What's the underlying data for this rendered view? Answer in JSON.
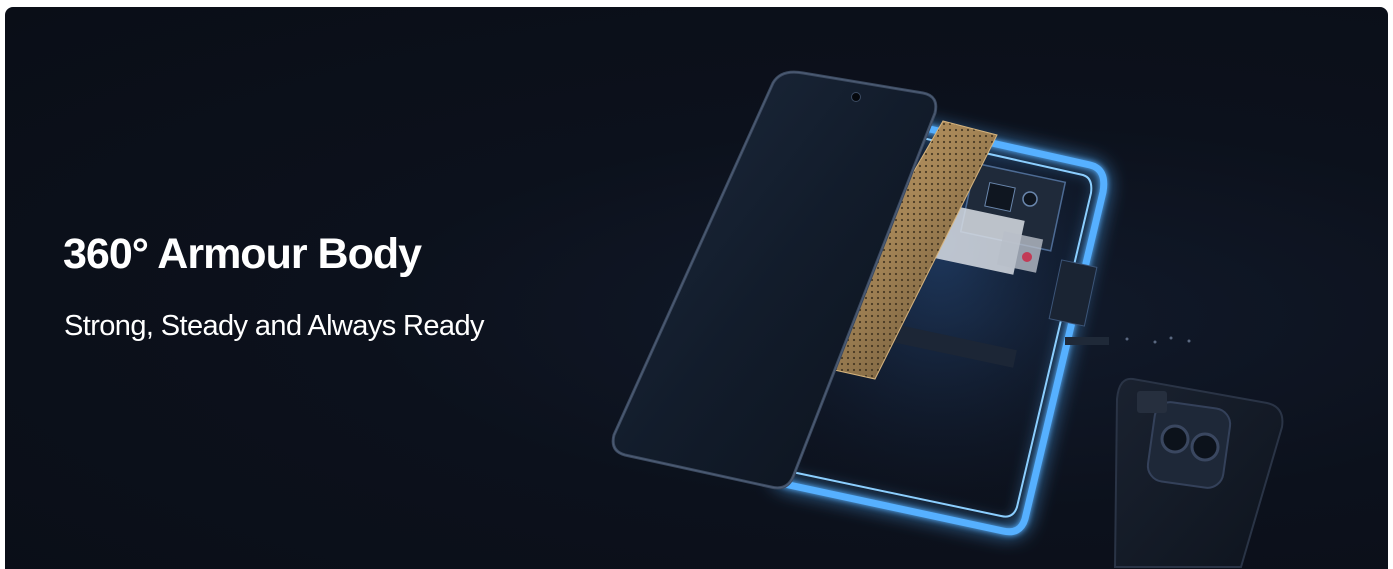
{
  "banner": {
    "title": "360° Armour Body",
    "subtitle": "Strong, Steady and Always Ready"
  },
  "colors": {
    "background": "#0b0f18",
    "text": "#ffffff",
    "frame_glow": "#4aa8ff",
    "shield_gold": "#a58556"
  },
  "illustration": "exploded-phone-illustration"
}
